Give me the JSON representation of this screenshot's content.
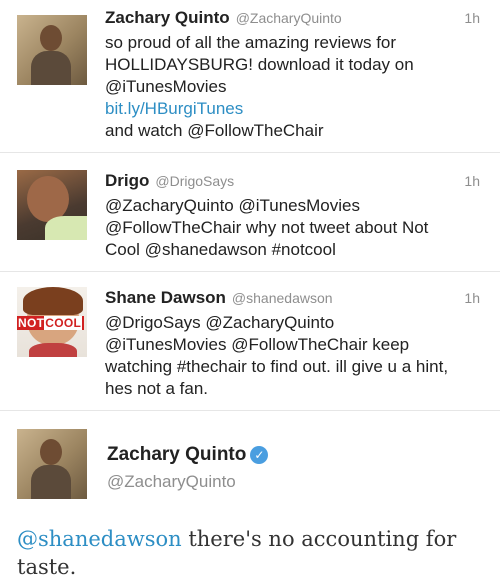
{
  "tweets": [
    {
      "name": "Zachary Quinto",
      "handle": "@ZacharyQuinto",
      "time": "1h",
      "lines": [
        "so proud of all the amazing reviews for",
        "HOLLIDAYSBURG! download it today on",
        "@iTunesMovies"
      ],
      "link": "bit.ly/HBurgiTunes",
      "after": "and watch @FollowTheChair"
    },
    {
      "name": "Drigo",
      "handle": "@DrigoSays",
      "time": "1h",
      "lines": [
        "@ZacharyQuinto @iTunesMovies",
        "@FollowTheChair why not tweet about Not",
        "Cool @shanedawson #notcool"
      ]
    },
    {
      "name": "Shane Dawson",
      "handle": "@shanedawson",
      "time": "1h",
      "badge_not": "NOT",
      "badge_cool": "COOL",
      "lines": [
        "@DrigoSays @ZacharyQuinto",
        "@iTunesMovies @FollowTheChair keep",
        "watching #thechair to find out. ill give u a hint,",
        "hes not a fan."
      ]
    }
  ],
  "expanded": {
    "name": "Zachary Quinto",
    "verified_icon": "verified-check-icon",
    "handle": "@ZacharyQuinto",
    "mention": "@shanedawson",
    "text_line1": " there's no accounting for",
    "text_line2": "taste."
  },
  "colors": {
    "link": "#2d8ec4",
    "muted": "#8e8e8e",
    "verified": "#4a9ee0",
    "notcool_red": "#d12121"
  }
}
